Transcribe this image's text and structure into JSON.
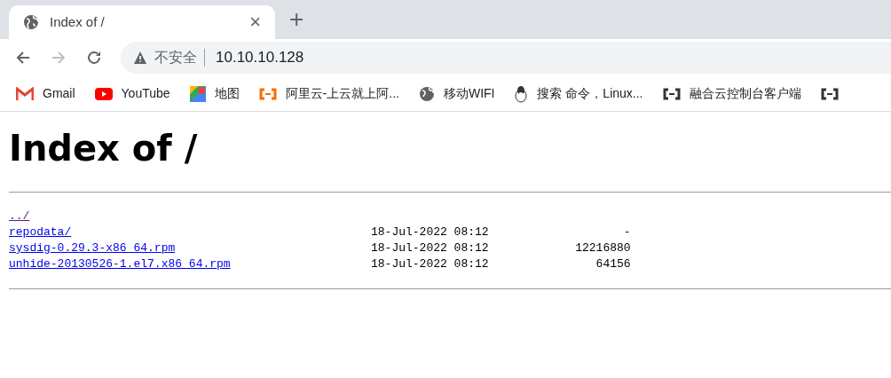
{
  "tab": {
    "title": "Index of /",
    "close": "×"
  },
  "new_tab": "+",
  "address": {
    "security": "不安全",
    "url": "10.10.10.128"
  },
  "bookmarks": [
    {
      "label": "Gmail",
      "kind": "gmail"
    },
    {
      "label": "YouTube",
      "kind": "youtube"
    },
    {
      "label": "地图",
      "kind": "maps"
    },
    {
      "label": "阿里云-上云就上阿...",
      "kind": "aliyun"
    },
    {
      "label": "移动WIFI",
      "kind": "globe"
    },
    {
      "label": "搜索 命令，Linux...",
      "kind": "penguin"
    },
    {
      "label": "融合云控制台客户端",
      "kind": "cloud"
    },
    {
      "kind": "cloud"
    }
  ],
  "heading": "Index of /",
  "rows": [
    {
      "name": "../",
      "visited": true
    },
    {
      "name": "repodata/",
      "visited": false,
      "date": "18-Jul-2022 08:12",
      "size": "-"
    },
    {
      "name": "sysdig-0.29.3-x86_64.rpm",
      "visited": false,
      "date": "18-Jul-2022 08:12",
      "size": "12216880"
    },
    {
      "name": "unhide-20130526-1.el7.x86_64.rpm",
      "visited": false,
      "date": "18-Jul-2022 08:12",
      "size": "64156"
    }
  ]
}
